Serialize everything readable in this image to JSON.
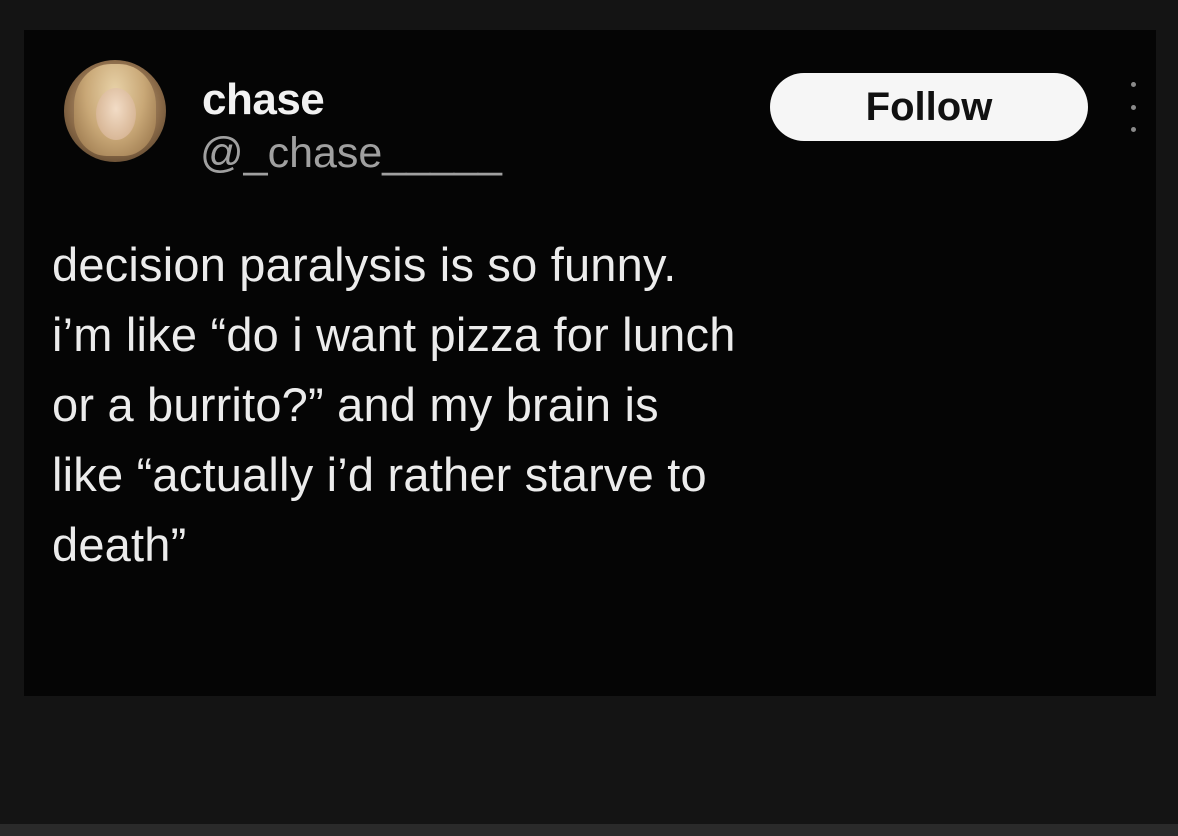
{
  "tweet": {
    "author": {
      "display_name": "chase",
      "handle": "@_chase_____",
      "avatar_icon": "user-avatar-photo"
    },
    "follow_label": "Follow",
    "more_icon": "vertical-ellipsis-icon",
    "text_lines": [
      "decision paralysis is so funny.",
      "i’m like “do i want pizza for lunch",
      "or a burrito?” and my brain is",
      "like “actually i’d rather starve to",
      "death”"
    ]
  },
  "colors": {
    "card_background": "#050505",
    "frame_background": "#141414",
    "text_primary": "#ececec",
    "text_secondary": "#a0a0a0",
    "button_background": "#f6f6f6"
  }
}
